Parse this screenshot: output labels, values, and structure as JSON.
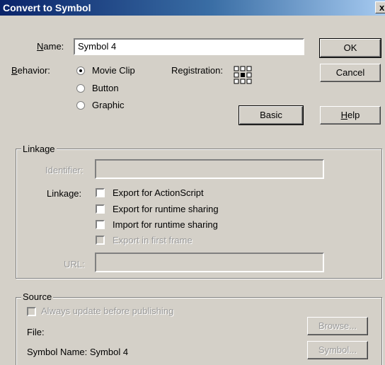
{
  "dialog": {
    "title": "Convert to Symbol",
    "close": "x"
  },
  "name_field": {
    "label": "Name:",
    "value": "Symbol 4"
  },
  "behavior": {
    "label": "Behavior:",
    "options": [
      "Movie Clip",
      "Button",
      "Graphic"
    ],
    "selected": "Movie Clip"
  },
  "registration": {
    "label": "Registration:"
  },
  "buttons": {
    "ok": "OK",
    "cancel": "Cancel",
    "basic": "Basic",
    "help": "Help"
  },
  "linkage": {
    "group_label": "Linkage",
    "identifier_label": "Identifier:",
    "identifier_value": "",
    "linkage_label": "Linkage:",
    "checks": [
      "Export for ActionScript",
      "Export for runtime sharing",
      "Import for runtime sharing",
      "Export in first frame"
    ],
    "url_label": "URL:",
    "url_value": ""
  },
  "source": {
    "group_label": "Source",
    "always_update": "Always update before publishing",
    "file_label": "File:",
    "symbol_name_label": "Symbol Name: Symbol 4",
    "browse_button": "Browse...",
    "symbol_button": "Symbol..."
  }
}
